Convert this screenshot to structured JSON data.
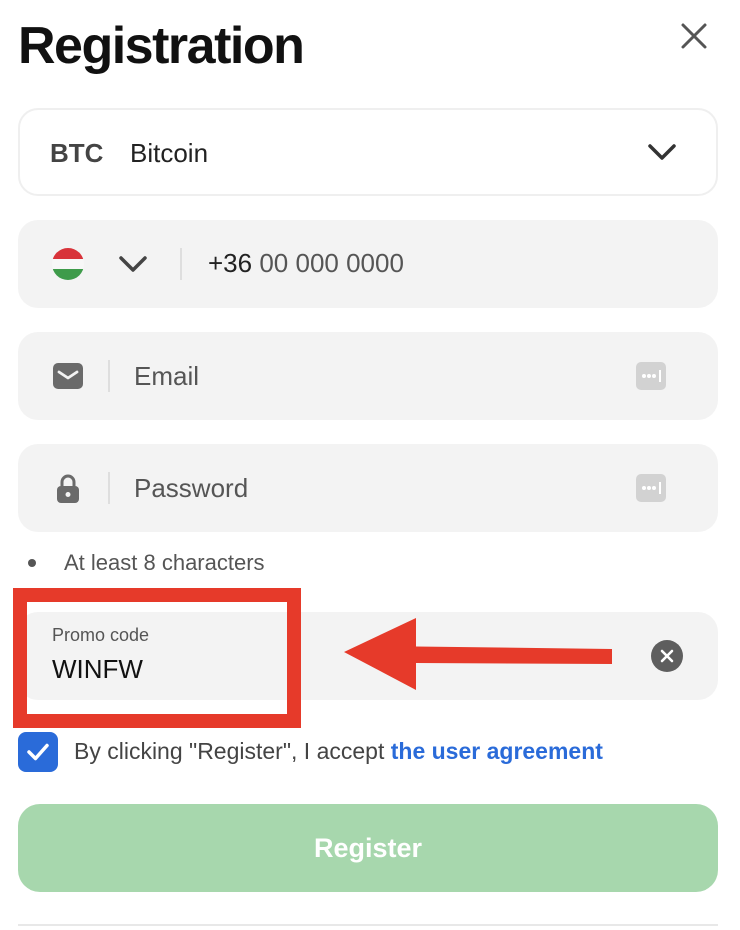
{
  "header": {
    "title": "Registration"
  },
  "currency": {
    "code": "BTC",
    "name": "Bitcoin"
  },
  "phone": {
    "country_code": "+36",
    "placeholder": "00 000 0000"
  },
  "email": {
    "placeholder": "Email"
  },
  "password": {
    "placeholder": "Password",
    "hint": "At least 8 characters"
  },
  "promo": {
    "label": "Promo code",
    "value": "WINFW"
  },
  "agreement": {
    "text": "By clicking \"Register\", I accept ",
    "link": "the user agreement",
    "checked": true
  },
  "register": {
    "label": "Register"
  },
  "colors": {
    "accent_blue": "#2a6bd9",
    "register_green": "#a7d7ad",
    "highlight_red": "#e63a2a"
  }
}
